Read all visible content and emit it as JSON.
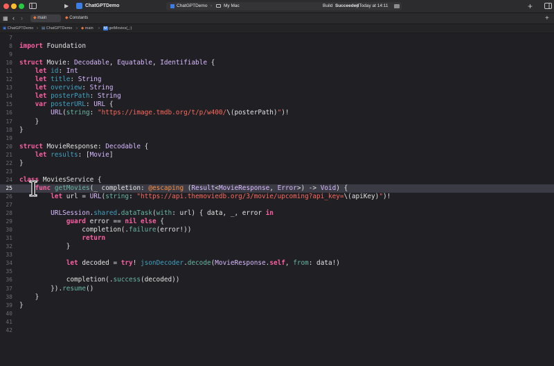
{
  "window": {
    "scheme_name": "ChatGPTDemo",
    "destination": "ChatGPTDemo",
    "device": "My Mac",
    "status_label": "Build",
    "status_result": "Succeeded",
    "status_time": "| Today at 14:11"
  },
  "tabs": [
    {
      "label": "main",
      "active": true
    },
    {
      "label": "Constants",
      "active": false
    }
  ],
  "breadcrumb": [
    "ChatGPTDemo",
    "ChatGPTDemo",
    "main",
    "getMovies(_:)"
  ],
  "editor": {
    "current_line": 25,
    "lines": [
      {
        "n": "7",
        "t": []
      },
      {
        "n": "8",
        "t": [
          [
            "kw",
            "import"
          ],
          [
            "",
            "Foundation"
          ]
        ]
      },
      {
        "n": "9",
        "t": []
      },
      {
        "n": "10",
        "t": [
          [
            "kw",
            "struct"
          ],
          [
            "",
            "Movie: "
          ],
          [
            "ty",
            "Decodable"
          ],
          [
            "",
            ", "
          ],
          [
            "ty",
            "Equatable"
          ],
          [
            "",
            ", "
          ],
          [
            "ty",
            "Identifiable"
          ],
          [
            "",
            " {"
          ]
        ]
      },
      {
        "n": "11",
        "t": [
          [
            "",
            "    "
          ],
          [
            "kw",
            "let"
          ],
          [
            "",
            ""
          ],
          [
            "pr",
            "id"
          ],
          [
            "",
            ": "
          ],
          [
            "ty",
            "Int"
          ]
        ]
      },
      {
        "n": "12",
        "t": [
          [
            "",
            "    "
          ],
          [
            "kw",
            "let"
          ],
          [
            "",
            ""
          ],
          [
            "pr",
            "title"
          ],
          [
            "",
            ": "
          ],
          [
            "ty",
            "String"
          ]
        ]
      },
      {
        "n": "13",
        "t": [
          [
            "",
            "    "
          ],
          [
            "kw",
            "let"
          ],
          [
            "",
            ""
          ],
          [
            "pr",
            "overview"
          ],
          [
            "",
            ": "
          ],
          [
            "ty",
            "String"
          ]
        ]
      },
      {
        "n": "14",
        "t": [
          [
            "",
            "    "
          ],
          [
            "kw",
            "let"
          ],
          [
            "",
            ""
          ],
          [
            "pr",
            "posterPath"
          ],
          [
            "",
            ": "
          ],
          [
            "ty",
            "String"
          ]
        ]
      },
      {
        "n": "15",
        "t": [
          [
            "",
            "    "
          ],
          [
            "kw",
            "var"
          ],
          [
            "",
            ""
          ],
          [
            "pr",
            "posterURL"
          ],
          [
            "",
            ": "
          ],
          [
            "ty",
            "URL"
          ],
          [
            "",
            " {"
          ]
        ]
      },
      {
        "n": "16",
        "t": [
          [
            "",
            "        "
          ],
          [
            "ty",
            "URL"
          ],
          [
            "",
            "("
          ],
          [
            "fn",
            "string"
          ],
          [
            "",
            ": "
          ],
          [
            "st",
            "\"https://image.tmdb.org/t/p/w400/"
          ],
          [
            "",
            "\\(posterPath)"
          ],
          [
            "st",
            "\""
          ],
          [
            "",
            ")!"
          ]
        ]
      },
      {
        "n": "17",
        "t": [
          [
            "",
            "    }"
          ]
        ]
      },
      {
        "n": "18",
        "t": [
          [
            "",
            "}"
          ]
        ]
      },
      {
        "n": "19",
        "t": []
      },
      {
        "n": "20",
        "t": [
          [
            "kw",
            "struct"
          ],
          [
            "",
            "MovieResponse: "
          ],
          [
            "ty",
            "Decodable"
          ],
          [
            "",
            " {"
          ]
        ]
      },
      {
        "n": "21",
        "t": [
          [
            "",
            "    "
          ],
          [
            "kw",
            "let"
          ],
          [
            "",
            ""
          ],
          [
            "pr",
            "results"
          ],
          [
            "",
            ": ["
          ],
          [
            "ty",
            "Movie"
          ],
          [
            "",
            "]"
          ]
        ]
      },
      {
        "n": "22",
        "t": [
          [
            "",
            "}"
          ]
        ]
      },
      {
        "n": "23",
        "t": []
      },
      {
        "n": "24",
        "t": [
          [
            "kw",
            "class"
          ],
          [
            "",
            "MoviesService {"
          ]
        ]
      },
      {
        "n": "25",
        "t": [
          [
            "",
            "    "
          ],
          [
            "kw",
            "func"
          ],
          [
            "",
            " "
          ],
          [
            "fn",
            "getMovies"
          ],
          [
            "",
            "(_ completion: "
          ],
          [
            "at",
            "@escaping"
          ],
          [
            "",
            " ("
          ],
          [
            "ty",
            "Result"
          ],
          [
            "",
            "<"
          ],
          [
            "ty",
            "MovieResponse"
          ],
          [
            "",
            ", "
          ],
          [
            "ty",
            "Error"
          ],
          [
            "",
            ">) -> "
          ],
          [
            "ty",
            "Void"
          ],
          [
            "",
            ") {"
          ]
        ]
      },
      {
        "n": "26",
        "t": [
          [
            "",
            "        "
          ],
          [
            "kw",
            "let"
          ],
          [
            "",
            " url = "
          ],
          [
            "ty",
            "URL"
          ],
          [
            "",
            "("
          ],
          [
            "fn",
            "string"
          ],
          [
            "",
            ": "
          ],
          [
            "st",
            "\"https://api.themoviedb.org/3/movie/upcoming?api_key="
          ],
          [
            "",
            "\\(apiKey)"
          ],
          [
            "st",
            "\""
          ],
          [
            "",
            ")!"
          ]
        ]
      },
      {
        "n": "27",
        "t": []
      },
      {
        "n": "28",
        "t": [
          [
            "",
            "        "
          ],
          [
            "ty",
            "URLSession"
          ],
          [
            "",
            "."
          ],
          [
            "pr",
            "shared"
          ],
          [
            "",
            "."
          ],
          [
            "fn",
            "dataTask"
          ],
          [
            "",
            "("
          ],
          [
            "fn",
            "with"
          ],
          [
            "",
            ": url) { data, _, error "
          ],
          [
            "kw",
            "in"
          ]
        ]
      },
      {
        "n": "29",
        "t": [
          [
            "",
            "            "
          ],
          [
            "kw",
            "guard"
          ],
          [
            "",
            " error == "
          ],
          [
            "kw",
            "nil"
          ],
          [
            "",
            " "
          ],
          [
            "kw",
            "else"
          ],
          [
            "",
            " {"
          ]
        ]
      },
      {
        "n": "30",
        "t": [
          [
            "",
            "                completion(."
          ],
          [
            "fn",
            "failure"
          ],
          [
            "",
            "(error!))"
          ]
        ]
      },
      {
        "n": "31",
        "t": [
          [
            "",
            "                "
          ],
          [
            "kw",
            "return"
          ]
        ]
      },
      {
        "n": "32",
        "t": [
          [
            "",
            "            }"
          ]
        ]
      },
      {
        "n": "33",
        "t": []
      },
      {
        "n": "34",
        "t": [
          [
            "",
            "            "
          ],
          [
            "kw",
            "let"
          ],
          [
            "",
            " decoded = "
          ],
          [
            "kw",
            "try"
          ],
          [
            "",
            "! "
          ],
          [
            "pr",
            "jsonDecoder"
          ],
          [
            "",
            "."
          ],
          [
            "fn",
            "decode"
          ],
          [
            "",
            "("
          ],
          [
            "ty",
            "MovieResponse"
          ],
          [
            "",
            "."
          ],
          [
            "kw",
            "self"
          ],
          [
            "",
            ", "
          ],
          [
            "fn",
            "from"
          ],
          [
            "",
            ": data!)"
          ]
        ]
      },
      {
        "n": "35",
        "t": []
      },
      {
        "n": "36",
        "t": [
          [
            "",
            "            completion(."
          ],
          [
            "fn",
            "success"
          ],
          [
            "",
            "(decoded))"
          ]
        ]
      },
      {
        "n": "37",
        "t": [
          [
            "",
            "        })."
          ],
          [
            "fn",
            "resume"
          ],
          [
            "",
            "()"
          ]
        ]
      },
      {
        "n": "38",
        "t": [
          [
            "",
            "    }"
          ]
        ]
      },
      {
        "n": "39",
        "t": [
          [
            "",
            "}"
          ]
        ]
      },
      {
        "n": "40",
        "t": []
      },
      {
        "n": "41",
        "t": []
      },
      {
        "n": "42",
        "t": []
      }
    ]
  },
  "colors": {
    "keyword": "#fc5fa3",
    "type": "#dabaff",
    "function": "#67b7a4",
    "property": "#41a1c0",
    "string": "#fc6a5d",
    "attribute": "#fd8f3f",
    "current_line_bg": "#3b3b45",
    "editor_bg": "#1f1f24"
  },
  "icons": [
    "sidebar-toggle-icon",
    "run-icon",
    "stop-icon",
    "scheme-app-icon",
    "destination-mac-icon",
    "build-status-icon",
    "library-plus-icon",
    "inspector-toggle-icon",
    "grid-icon",
    "back-chevron-icon",
    "forward-chevron-icon",
    "swift-file-icon",
    "add-tab-icon",
    "text-cursor-icon"
  ]
}
